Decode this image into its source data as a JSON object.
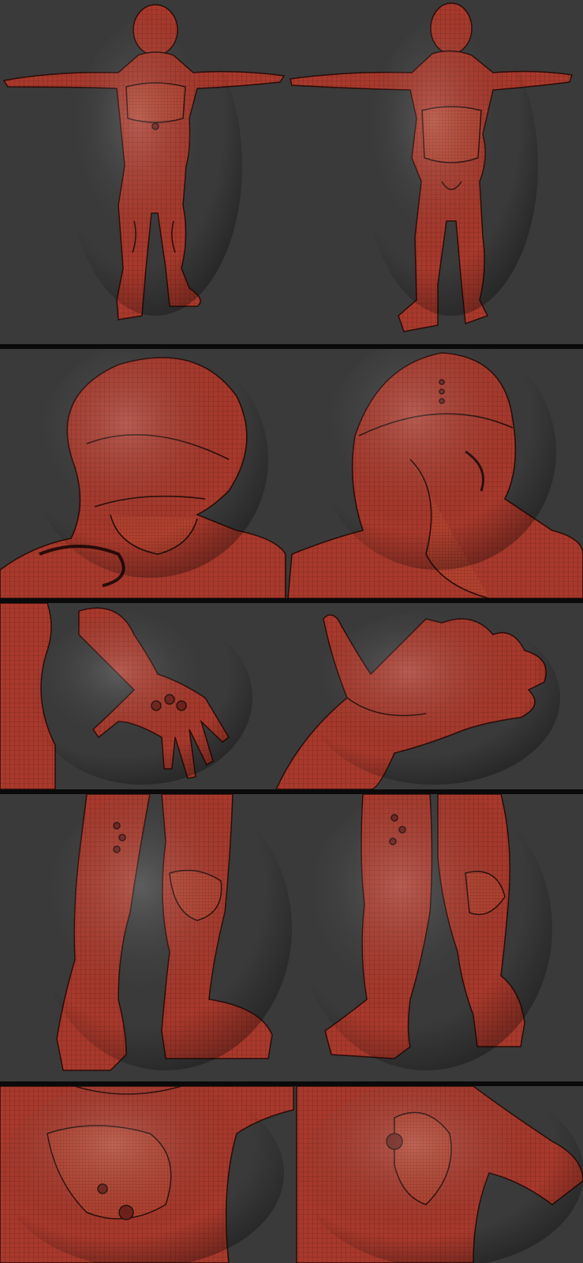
{
  "title": "",
  "colors": {
    "background": "#3a3a3a",
    "divider": "#0a0a0a",
    "clay": "#a8392c",
    "clay_light": "#c9574a",
    "clay_dark": "#6e2018",
    "wire": "#2a0c08"
  },
  "panels": [
    {
      "name": "full-body-front-back",
      "views": [
        "front",
        "back"
      ]
    },
    {
      "name": "head-closeup",
      "views": [
        "front",
        "back"
      ]
    },
    {
      "name": "hand-closeup",
      "views": [
        "back-of-hand",
        "palm"
      ]
    },
    {
      "name": "legs-closeup",
      "views": [
        "front",
        "back"
      ]
    },
    {
      "name": "torso-closeup",
      "views": [
        "chest",
        "back"
      ]
    }
  ]
}
